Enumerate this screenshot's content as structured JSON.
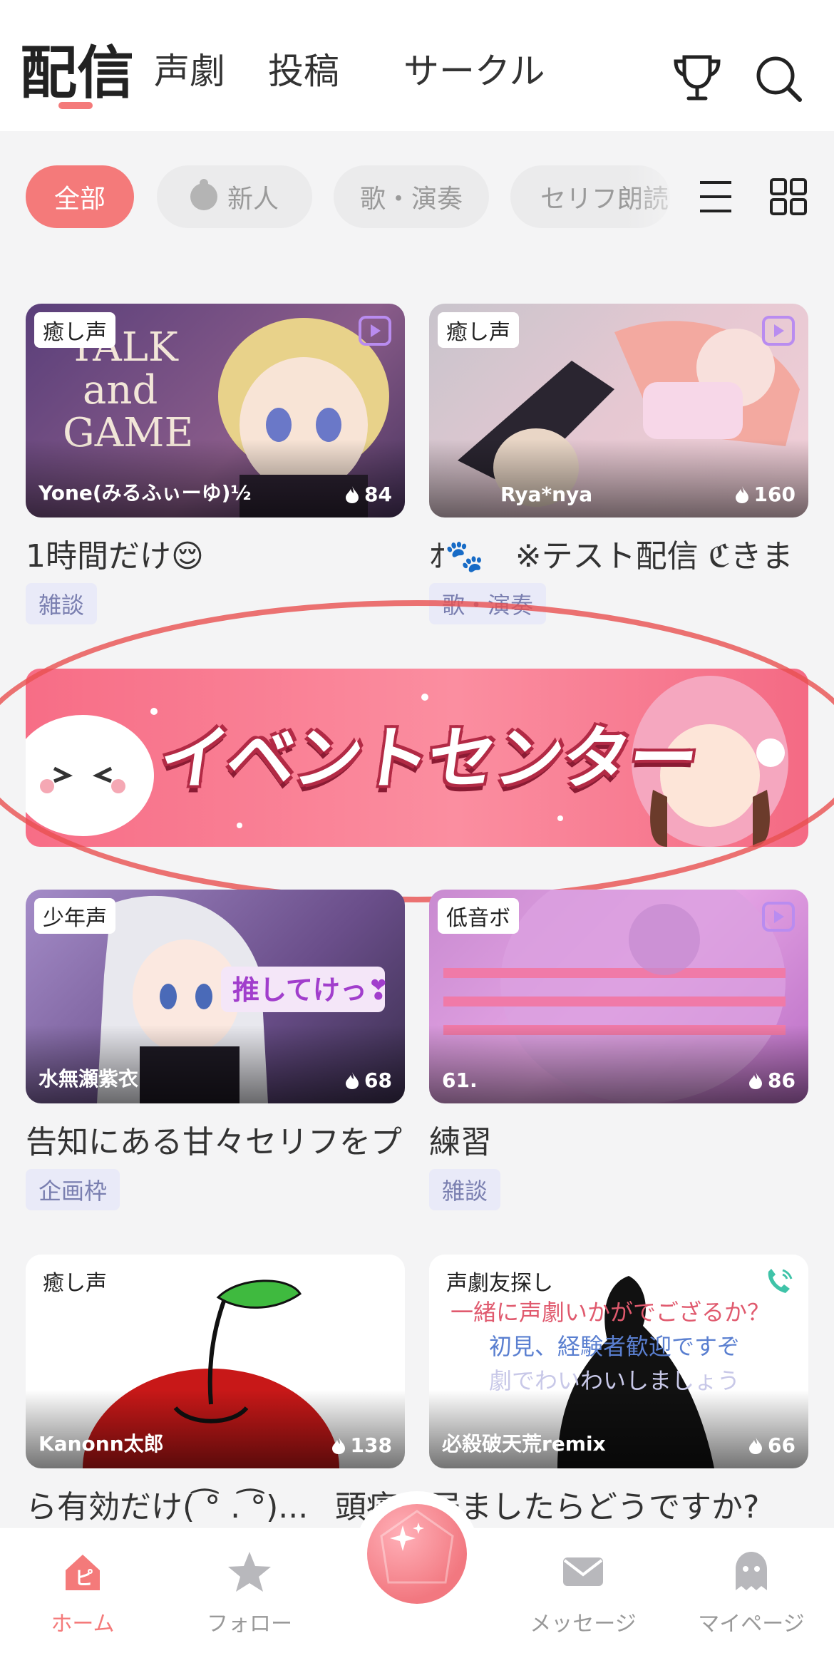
{
  "header": {
    "tabs": [
      {
        "label": "配信",
        "active": true
      },
      {
        "label": "声劇"
      },
      {
        "label": "投稿"
      },
      {
        "label": "サークル"
      }
    ],
    "icons": [
      "trophy-icon",
      "search-icon"
    ]
  },
  "filters": {
    "chips": [
      "全部",
      "新人",
      "歌・演奏",
      "セリフ朗読"
    ],
    "view_icons": [
      "list-view-icon",
      "grid-view-icon"
    ]
  },
  "cards": [
    {
      "badge": "癒し声",
      "streamer": "Yone(みるふぃーゆ)½",
      "viewers": "84",
      "title": "1時間だけ😌",
      "genre": "雑談",
      "thumb_text": [
        "TALK",
        "and",
        "GAME"
      ]
    },
    {
      "badge": "癒し声",
      "streamer": "Rya*nya",
      "viewers": "160",
      "title": "ｵ🐾　※テスト配信 ℭきま",
      "genre": "歌・演奏"
    },
    {
      "badge": "少年声",
      "streamer": "水無瀬紫衣",
      "viewers": "68",
      "title": "告知にある甘々セリフをプ|",
      "genre": "企画枠",
      "thumb_text": [
        "推してけっ❣"
      ]
    },
    {
      "badge": "低音ボ",
      "streamer": "61.",
      "viewers": "86",
      "title": "練習",
      "genre": "雑談"
    },
    {
      "badge": "癒し声",
      "streamer": "Kanonn太郎",
      "viewers": "138",
      "title": "ら有効だけ( ͡° . ͡°)..."
    },
    {
      "badge": "声劇友探し",
      "streamer": "必殺破天荒remix",
      "viewers": "66",
      "title": "頭痛　居ましたらどうですか?",
      "overlay": [
        "一緒に声劇いかがでござるか？",
        "初見、経験者歓迎ですぞ",
        "劇でわいわいしましょう"
      ]
    }
  ],
  "banner": {
    "text": "イベントセンター"
  },
  "bottom_nav": {
    "items": [
      "ホーム",
      "フォロー",
      "メッセージ",
      "マイページ"
    ],
    "home_glyph": "ピ"
  },
  "colors": {
    "accent": "#f47a7a",
    "genre_bg": "#e9eaf8",
    "genre_text": "#7a7fb0"
  }
}
